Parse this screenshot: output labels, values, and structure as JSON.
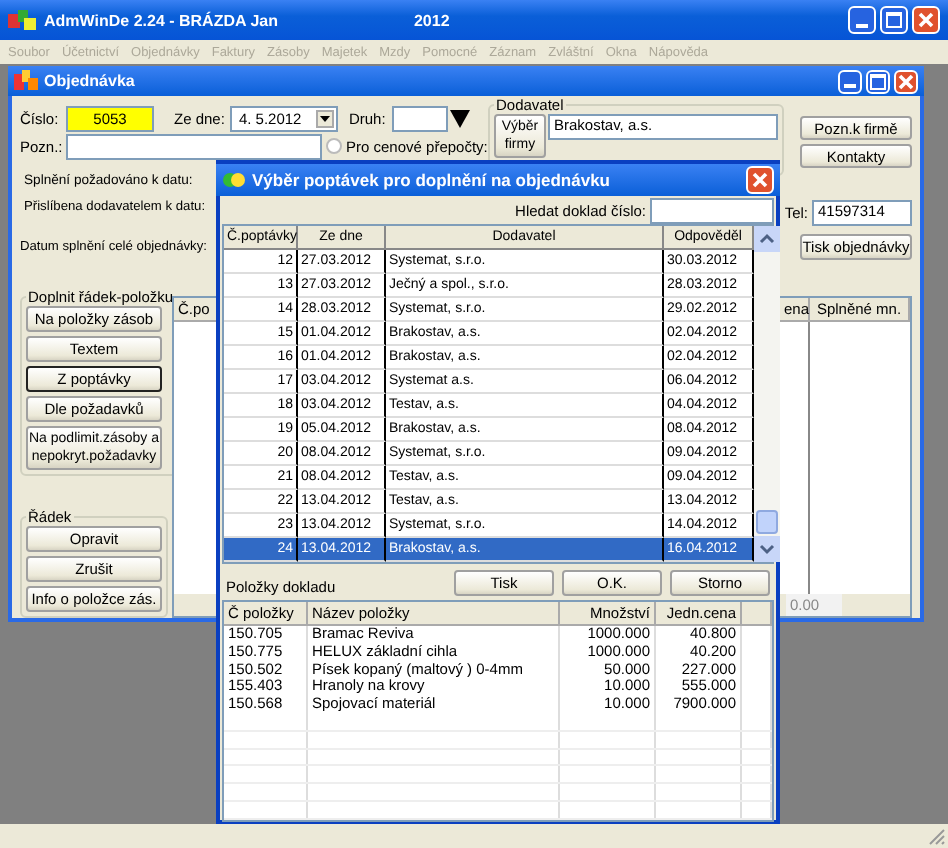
{
  "window": {
    "title": "AdmWinDe 2.24 - BRÁZDA Jan",
    "year": "2012"
  },
  "menu": {
    "disabled": true,
    "items": [
      "Soubor",
      "Účetnictví",
      "Objednávky",
      "Faktury",
      "Zásoby",
      "Majetek",
      "Mzdy",
      "Pomocné",
      "Záznam",
      "Zvláštní",
      "Okna",
      "Nápověda"
    ]
  },
  "order_window": {
    "title": "Objednávka",
    "number_label": "Číslo:",
    "number": "5053",
    "date_label": "Ze dne:",
    "date": "4. 5.2012",
    "type_label": "Druh:",
    "note_label": "Pozn.:",
    "price_option": {
      "label": "Pro cenové přepočty:",
      "checked": false
    },
    "supplier": {
      "group_label": "Dodavatel",
      "pick_button": "Výběr firmy",
      "name": "Brakostav, a.s."
    },
    "side_buttons": [
      "Pozn.k firmě",
      "Kontakty"
    ],
    "requested_label": "Splnění požadováno k datu:",
    "promised_label": "Přislíbena dodavatelem k datu:",
    "completed_label": "Datum splnění celé objednávky:",
    "phone_label": "Tel:",
    "phone": "41597314",
    "print_button": "Tisk objednávky",
    "add_row": {
      "label": "Doplnit řádek-položku",
      "buttons": [
        {
          "label": "Na položky zásob",
          "selected": false
        },
        {
          "label": "Textem",
          "selected": false
        },
        {
          "label": "Z poptávky",
          "selected": true
        },
        {
          "label": "Dle požadavků",
          "selected": false
        },
        {
          "label": "Na podlimit.zásoby a nepokryt.požadavky",
          "selected": false
        }
      ]
    },
    "row_group": {
      "label": "Řádek",
      "buttons": [
        "Opravit",
        "Zrušit",
        "Info o položce zás."
      ]
    },
    "table": {
      "columns": [
        "Č.po",
        "ena",
        "Splněné mn."
      ],
      "total": "0.00"
    }
  },
  "dialog": {
    "title": "Výběr poptávek pro doplnění na objednávku",
    "search_label": "Hledat doklad číslo:",
    "columns": [
      "Č.poptávky",
      "Ze dne",
      "Dodavatel",
      "Odpověděl"
    ],
    "rows": [
      {
        "number": "12",
        "date": "27.03.2012",
        "supplier": "Systemat, s.r.o.",
        "answered": "30.03.2012",
        "selected": false
      },
      {
        "number": "13",
        "date": "27.03.2012",
        "supplier": "Ječný a spol., s.r.o.",
        "answered": "28.03.2012",
        "selected": false
      },
      {
        "number": "14",
        "date": "28.03.2012",
        "supplier": "Systemat, s.r.o.",
        "answered": "29.02.2012",
        "selected": false
      },
      {
        "number": "15",
        "date": "01.04.2012",
        "supplier": "Brakostav, a.s.",
        "answered": "02.04.2012",
        "selected": false
      },
      {
        "number": "16",
        "date": "01.04.2012",
        "supplier": "Brakostav, a.s.",
        "answered": "02.04.2012",
        "selected": false
      },
      {
        "number": "17",
        "date": "03.04.2012",
        "supplier": "Systemat a.s.",
        "answered": "06.04.2012",
        "selected": false
      },
      {
        "number": "18",
        "date": "03.04.2012",
        "supplier": "Testav, a.s.",
        "answered": "04.04.2012",
        "selected": false
      },
      {
        "number": "19",
        "date": "05.04.2012",
        "supplier": "Brakostav, a.s.",
        "answered": "08.04.2012",
        "selected": false
      },
      {
        "number": "20",
        "date": "08.04.2012",
        "supplier": "Systemat, s.r.o.",
        "answered": "09.04.2012",
        "selected": false
      },
      {
        "number": "21",
        "date": "08.04.2012",
        "supplier": "Testav, a.s.",
        "answered": "09.04.2012",
        "selected": false
      },
      {
        "number": "22",
        "date": "13.04.2012",
        "supplier": "Testav, a.s.",
        "answered": "13.04.2012",
        "selected": false
      },
      {
        "number": "23",
        "date": "13.04.2012",
        "supplier": "Systemat, s.r.o.",
        "answered": "14.04.2012",
        "selected": false
      },
      {
        "number": "24",
        "date": "13.04.2012",
        "supplier": "Brakostav, a.s.",
        "answered": "16.04.2012",
        "selected": true
      }
    ],
    "items_label": "Položky dokladu",
    "buttons": [
      "Tisk",
      "O.K.",
      "Storno"
    ],
    "item_columns": [
      "Č položky",
      "Název položky",
      "Množství",
      "Jedn.cena"
    ],
    "items": [
      {
        "code": "150.705",
        "name": "Bramac Reviva",
        "quantity": "1000.000",
        "price": "40.800"
      },
      {
        "code": "150.775",
        "name": "HELUX základní cihla",
        "quantity": "1000.000",
        "price": "40.200"
      },
      {
        "code": "150.502",
        "name": "Písek kopaný (maltový ) 0-4mm",
        "quantity": "50.000",
        "price": "227.000"
      },
      {
        "code": "155.403",
        "name": "Hranoly na krovy",
        "quantity": "10.000",
        "price": "555.000"
      },
      {
        "code": "150.568",
        "name": "Spojovací materiál",
        "quantity": "10.000",
        "price": "7900.000"
      }
    ]
  }
}
